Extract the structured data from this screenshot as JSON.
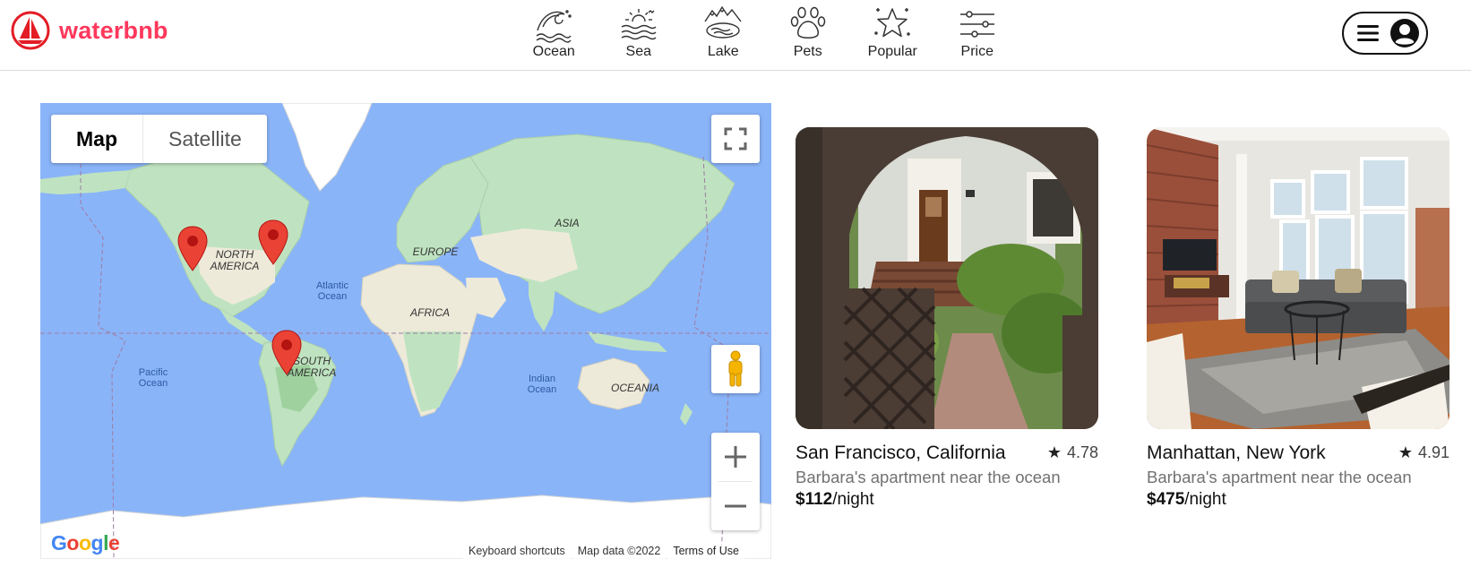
{
  "brand": {
    "name": "waterbnb",
    "accent": "#ff385c"
  },
  "categories": [
    {
      "label": "Ocean",
      "icon": "ocean-wave-icon"
    },
    {
      "label": "Sea",
      "icon": "sun-waves-icon"
    },
    {
      "label": "Lake",
      "icon": "mountain-lake-icon"
    },
    {
      "label": "Pets",
      "icon": "paw-icon"
    },
    {
      "label": "Popular",
      "icon": "star-icon"
    },
    {
      "label": "Price",
      "icon": "sliders-icon"
    }
  ],
  "map": {
    "type_map_label": "Map",
    "type_satellite_label": "Satellite",
    "labels": {
      "north_america": [
        "NORTH",
        "AMERICA"
      ],
      "south_america": [
        "SOUTH",
        "AMERICA"
      ],
      "europe": "EUROPE",
      "asia": "ASIA",
      "africa": "AFRICA",
      "oceania": "OCEANIA",
      "atlantic": [
        "Atlantic",
        "Ocean"
      ],
      "pacific": [
        "Pacific",
        "Ocean"
      ],
      "indian": [
        "Indian",
        "Ocean"
      ]
    },
    "attribution": {
      "shortcuts": "Keyboard shortcuts",
      "data": "Map data ©2022",
      "terms": "Terms of Use"
    },
    "logo_letters": [
      "G",
      "o",
      "o",
      "g",
      "l",
      "e"
    ],
    "logo_colors": [
      "#4285f4",
      "#ea4335",
      "#fbbc05",
      "#4285f4",
      "#34a853",
      "#ea4335"
    ],
    "water_color": "#8ab4f8",
    "land_color": "#bfe3c0",
    "pin_color": "#ea4335"
  },
  "listings": [
    {
      "location": "San Francisco, California",
      "rating": "4.78",
      "description": "Barbara's apartment near the ocean",
      "price": "$112",
      "price_unit": "/night"
    },
    {
      "location": "Manhattan, New York",
      "rating": "4.91",
      "description": "Barbara's apartment near the ocean",
      "price": "$475",
      "price_unit": "/night"
    }
  ]
}
